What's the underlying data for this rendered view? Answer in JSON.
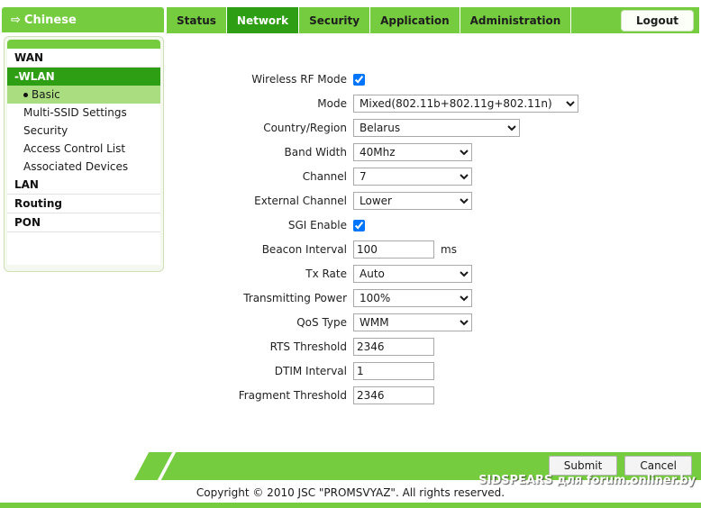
{
  "header": {
    "language_button": {
      "icon": "arrow-right-icon",
      "label": "Chinese"
    },
    "tabs": [
      {
        "label": "Status",
        "active": false
      },
      {
        "label": "Network",
        "active": true
      },
      {
        "label": "Security",
        "active": false
      },
      {
        "label": "Application",
        "active": false
      },
      {
        "label": "Administration",
        "active": false
      }
    ],
    "logout_label": "Logout"
  },
  "sidebar": {
    "items": [
      {
        "label": "WAN",
        "type": "top",
        "active": false
      },
      {
        "label": "-WLAN",
        "type": "top",
        "active": true
      },
      {
        "label": "Basic",
        "type": "sub",
        "selected": true
      },
      {
        "label": "Multi-SSID Settings",
        "type": "sub",
        "selected": false
      },
      {
        "label": "Security",
        "type": "sub",
        "selected": false
      },
      {
        "label": "Access Control List",
        "type": "sub",
        "selected": false
      },
      {
        "label": "Associated Devices",
        "type": "sub",
        "selected": false
      },
      {
        "label": "LAN",
        "type": "top",
        "active": false
      },
      {
        "label": "Routing",
        "type": "top",
        "active": false
      },
      {
        "label": "PON",
        "type": "top",
        "active": false
      }
    ]
  },
  "form": {
    "wireless_rf_mode": {
      "label": "Wireless RF Mode",
      "checked": true
    },
    "mode": {
      "label": "Mode",
      "value": "Mixed(802.11b+802.11g+802.11n)"
    },
    "country_region": {
      "label": "Country/Region",
      "value": "Belarus"
    },
    "band_width": {
      "label": "Band Width",
      "value": "40Mhz"
    },
    "channel": {
      "label": "Channel",
      "value": "7"
    },
    "external_channel": {
      "label": "External Channel",
      "value": "Lower"
    },
    "sgi_enable": {
      "label": "SGI Enable",
      "checked": true
    },
    "beacon_interval": {
      "label": "Beacon Interval",
      "value": "100",
      "suffix": "ms"
    },
    "tx_rate": {
      "label": "Tx Rate",
      "value": "Auto"
    },
    "transmitting_power": {
      "label": "Transmitting Power",
      "value": "100%"
    },
    "qos_type": {
      "label": "QoS Type",
      "value": "WMM"
    },
    "rts_threshold": {
      "label": "RTS Threshold",
      "value": "2346"
    },
    "dtim_interval": {
      "label": "DTIM Interval",
      "value": "1"
    },
    "fragment_threshold": {
      "label": "Fragment Threshold",
      "value": "2346"
    }
  },
  "footer": {
    "submit_label": "Submit",
    "cancel_label": "Cancel",
    "copyright": "Copyright © 2010 JSC \"PROMSVYAZ\". All rights reserved.",
    "watermark": "SIDSPEARS для forum.onliner.by"
  },
  "colors": {
    "brand_green": "#76cc3f",
    "active_green": "#2e9e14",
    "selected_sub": "#aadd80"
  }
}
